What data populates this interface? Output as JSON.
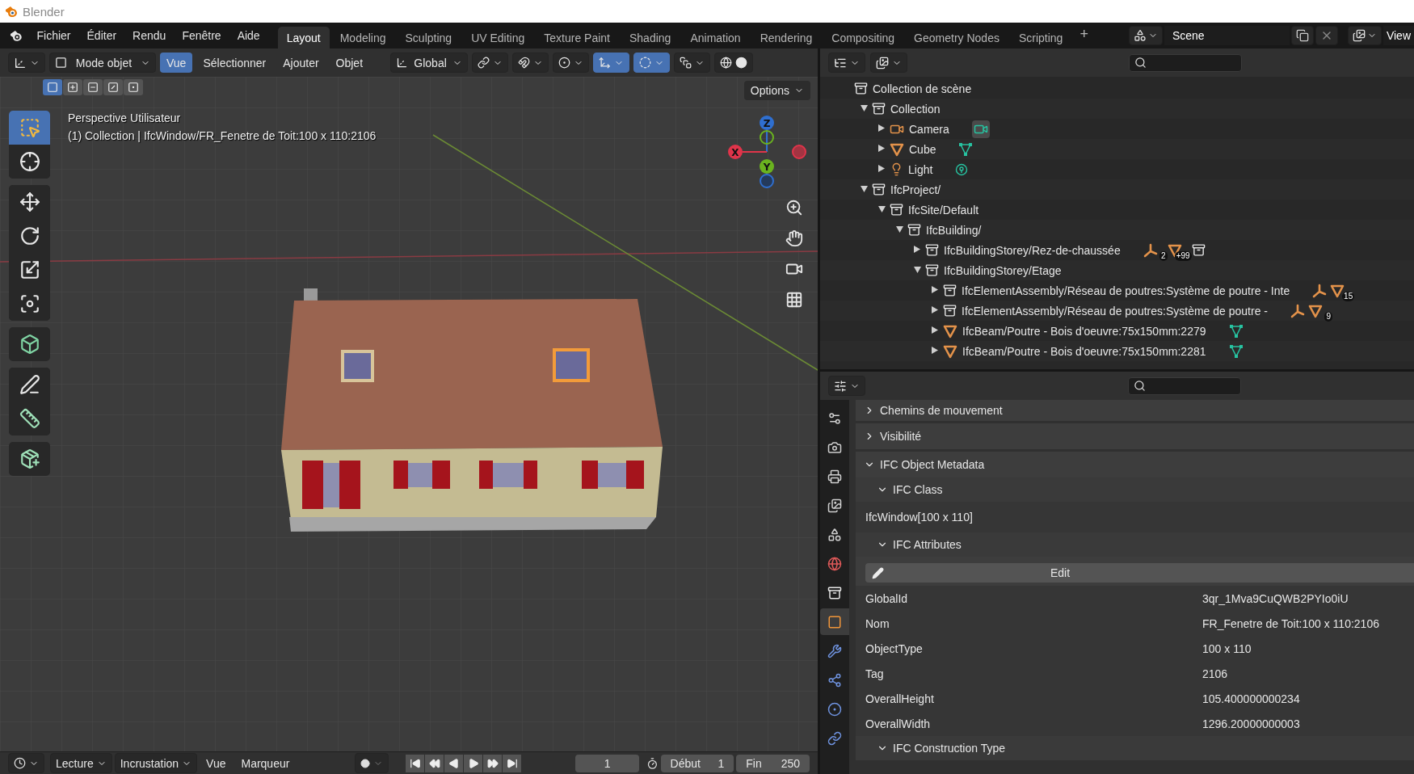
{
  "window": {
    "title": "Blender"
  },
  "menu": [
    "Fichier",
    "Éditer",
    "Rendu",
    "Fenêtre",
    "Aide"
  ],
  "workspaces": [
    {
      "label": "Layout",
      "selected": true
    },
    {
      "label": "Modeling",
      "selected": false
    },
    {
      "label": "Sculpting",
      "selected": false
    },
    {
      "label": "UV Editing",
      "selected": false
    },
    {
      "label": "Texture Paint",
      "selected": false
    },
    {
      "label": "Shading",
      "selected": false
    },
    {
      "label": "Animation",
      "selected": false
    },
    {
      "label": "Rendering",
      "selected": false
    },
    {
      "label": "Compositing",
      "selected": false
    },
    {
      "label": "Geometry Nodes",
      "selected": false
    },
    {
      "label": "Scripting",
      "selected": false
    }
  ],
  "add_workspace": "+",
  "scene": {
    "name": "Scene",
    "view_layer": "View"
  },
  "viewport": {
    "mode": "Mode objet",
    "menus": [
      {
        "label": "Vue",
        "selected": true
      },
      {
        "label": "Sélectionner",
        "selected": false
      },
      {
        "label": "Ajouter",
        "selected": false
      },
      {
        "label": "Objet",
        "selected": false
      }
    ],
    "orientation": "Global",
    "toggles": [
      {
        "kind": "snap",
        "on": false
      },
      {
        "kind": "proportional",
        "on": false
      },
      {
        "kind": "gizmo",
        "on": true
      },
      {
        "kind": "overlays",
        "on": true
      },
      {
        "kind": "xray",
        "on": false
      }
    ],
    "select_modes": [
      {
        "kind": "set",
        "selected": true
      },
      {
        "kind": "extend",
        "selected": false
      },
      {
        "kind": "subtract",
        "selected": false
      },
      {
        "kind": "invert",
        "selected": false
      },
      {
        "kind": "intersect",
        "selected": false
      }
    ],
    "options": "Options",
    "view_name": "Perspective Utilisateur",
    "object_info": "(1) Collection | IfcWindow/FR_Fenetre de Toit:100 x 110:2106",
    "tool_groups": [
      [
        {
          "kind": "select",
          "selected": true
        },
        {
          "kind": "cursor",
          "selected": false
        }
      ],
      [
        {
          "kind": "move",
          "selected": false
        },
        {
          "kind": "rotate",
          "selected": false
        },
        {
          "kind": "scale",
          "selected": false
        },
        {
          "kind": "transform",
          "selected": false
        }
      ],
      [
        {
          "kind": "add_cube",
          "selected": false
        }
      ],
      [
        {
          "kind": "annotate",
          "selected": false
        },
        {
          "kind": "measure",
          "selected": false
        }
      ],
      [
        {
          "kind": "add_primitive",
          "selected": false
        }
      ]
    ],
    "axes": [
      {
        "label": "Z"
      },
      {
        "label": "X"
      },
      {
        "label": "Y"
      }
    ]
  },
  "outliner": {
    "tree": [
      {
        "name": "Collection de scène",
        "kind": "collection",
        "children": [
          {
            "name": "Collection",
            "kind": "collection",
            "expanded": true,
            "children": [
              {
                "name": "Camera",
                "kind": "camera",
                "expanded": false,
                "extras": [
                  {
                    "kind": "camera_data"
                  }
                ]
              },
              {
                "name": "Cube",
                "kind": "mesh",
                "expanded": false,
                "extras": [
                  {
                    "kind": "mesh_data"
                  }
                ]
              },
              {
                "name": "Light",
                "kind": "light",
                "expanded": false,
                "extras": [
                  {
                    "kind": "light_data"
                  }
                ]
              }
            ]
          },
          {
            "name": "IfcProject/",
            "kind": "collection",
            "expanded": true,
            "children": [
              {
                "name": "IfcSite/Default",
                "kind": "collection",
                "expanded": true,
                "children": [
                  {
                    "name": "IfcBuilding/",
                    "kind": "collection",
                    "expanded": true,
                    "children": [
                      {
                        "name": "IfcBuildingStorey/Rez-de-chaussée",
                        "kind": "collection",
                        "expanded": false,
                        "extras": [
                          {
                            "kind": "empty",
                            "count": "2"
                          },
                          {
                            "kind": "mesh",
                            "count": "+99"
                          },
                          {
                            "kind": "collection"
                          }
                        ]
                      },
                      {
                        "name": "IfcBuildingStorey/Etage",
                        "kind": "collection",
                        "expanded": true,
                        "children": [
                          {
                            "name": "IfcElementAssembly/Réseau de poutres:Système de poutre - Inte",
                            "kind": "collection",
                            "expanded": false,
                            "extras": [
                              {
                                "kind": "empty"
                              },
                              {
                                "kind": "mesh",
                                "count": "15"
                              }
                            ]
                          },
                          {
                            "name": "IfcElementAssembly/Réseau de poutres:Système de poutre -",
                            "kind": "collection",
                            "expanded": false,
                            "extras": [
                              {
                                "kind": "empty"
                              },
                              {
                                "kind": "mesh",
                                "count": "9"
                              }
                            ]
                          },
                          {
                            "name": "IfcBeam/Poutre - Bois d'oeuvre:75x150mm:2279",
                            "kind": "mesh",
                            "expanded": false,
                            "extras": [
                              {
                                "kind": "mesh_data"
                              }
                            ]
                          },
                          {
                            "name": "IfcBeam/Poutre - Bois d'oeuvre:75x150mm:2281",
                            "kind": "mesh",
                            "expanded": false,
                            "extras": [
                              {
                                "kind": "mesh_data"
                              }
                            ]
                          }
                        ]
                      }
                    ]
                  }
                ]
              }
            ]
          }
        ]
      }
    ]
  },
  "properties": {
    "tabs": [
      {
        "kind": "tool",
        "selected": false
      },
      {
        "kind": "render",
        "selected": false
      },
      {
        "kind": "output",
        "selected": false
      },
      {
        "kind": "view_layer",
        "selected": false
      },
      {
        "kind": "scene",
        "selected": false
      },
      {
        "kind": "world",
        "selected": false
      },
      {
        "kind": "collection",
        "selected": false
      },
      {
        "kind": "object",
        "selected": true
      },
      {
        "kind": "modifiers",
        "selected": false
      },
      {
        "kind": "particles",
        "selected": false
      },
      {
        "kind": "physics",
        "selected": false
      },
      {
        "kind": "constraints",
        "selected": false
      }
    ],
    "panels": [
      {
        "title": "Chemins de mouvement",
        "expanded": false
      },
      {
        "title": "Visibilité",
        "expanded": false
      },
      {
        "title": "IFC Object Metadata",
        "expanded": true,
        "subpanels": [
          {
            "title": "IFC Class",
            "expanded": true,
            "value": "IfcWindow[100 x 110]"
          },
          {
            "title": "IFC Attributes",
            "expanded": true,
            "edit_button": "Edit",
            "attributes": [
              {
                "name": "GlobalId",
                "value": "3qr_1Mva9CuQWB2PYIo0iU"
              },
              {
                "name": "Nom",
                "value": "FR_Fenetre de Toit:100 x 110:2106"
              },
              {
                "name": "ObjectType",
                "value": "100 x 110"
              },
              {
                "name": "Tag",
                "value": "2106"
              },
              {
                "name": "OverallHeight",
                "value": "105.400000000234"
              },
              {
                "name": "OverallWidth",
                "value": "1296.20000000003"
              }
            ]
          },
          {
            "title": "IFC Construction Type",
            "expanded": true
          }
        ]
      }
    ]
  },
  "timeline": {
    "menus": [
      {
        "label": "Lecture",
        "kind": "dropdown"
      },
      {
        "label": "Incrustation",
        "kind": "dropdown"
      },
      {
        "label": "Vue",
        "kind": "menu"
      },
      {
        "label": "Marqueur",
        "kind": "menu"
      }
    ],
    "current_frame": "1",
    "start": {
      "label": "Début",
      "value": "1"
    },
    "end": {
      "label": "Fin",
      "value": "250"
    }
  }
}
